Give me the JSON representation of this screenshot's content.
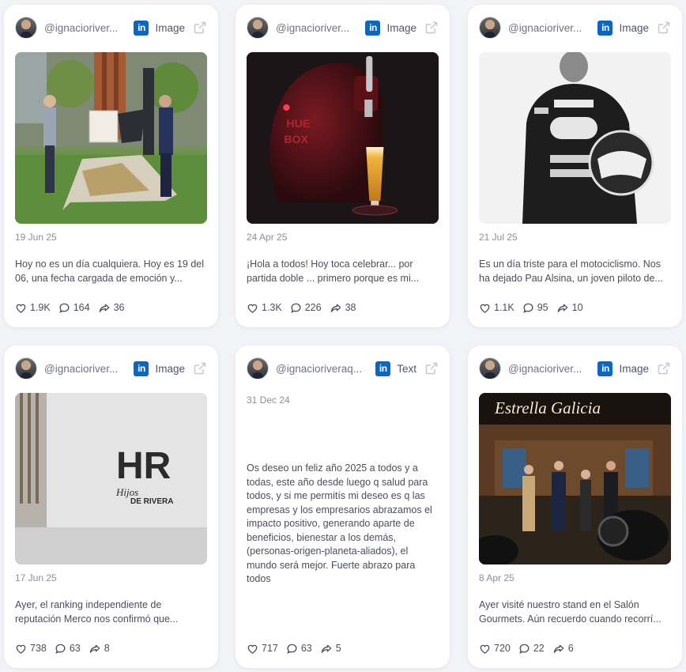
{
  "colors": {
    "background": "#f1f3f7",
    "card": "#ffffff",
    "linkedin": "#0a66c2",
    "muted": "#8a8f9c"
  },
  "posts": [
    {
      "handle": "@ignacioriver...",
      "network_icon": "linkedin-icon",
      "type": "Image",
      "date": "19 Jun 25",
      "text": "Hoy no es un día cualquiera. Hoy es 19 del 06, una fecha cargada de emoción y...",
      "likes": "1.9K",
      "comments": "164",
      "shares": "36"
    },
    {
      "handle": "@ignacioriver...",
      "network_icon": "linkedin-icon",
      "type": "Image",
      "date": "24 Apr 25",
      "text": "¡Hola a todos! Hoy toca celebrar... por partida doble ... primero porque es mi...",
      "likes": "1.3K",
      "comments": "226",
      "shares": "38"
    },
    {
      "handle": "@ignacioriver...",
      "network_icon": "linkedin-icon",
      "type": "Image",
      "date": "21 Jul 25",
      "text": "Es un día triste para el motociclismo. Nos ha dejado Pau Alsina, un joven piloto de...",
      "likes": "1.1K",
      "comments": "95",
      "shares": "10"
    },
    {
      "handle": "@ignacioriver...",
      "network_icon": "linkedin-icon",
      "type": "Image",
      "date": "17 Jun 25",
      "text": "Ayer, el ranking independiente de reputación Merco nos confirmó que...",
      "likes": "738",
      "comments": "63",
      "shares": "8",
      "media_logo": {
        "mark": "HR",
        "line1": "Hijos",
        "line2": "DE RIVERA"
      }
    },
    {
      "handle": "@ignacioriveraq...",
      "network_icon": "linkedin-icon",
      "type": "Text",
      "date": "31 Dec 24",
      "text": "Os deseo un feliz año 2025 a todos y a todas, este año desde luego q salud para todos, y si me permitís mi deseo es q las empresas y los empresarios abrazamos el impacto positivo, generando aparte de beneficios, bienestar a los demás, (personas-origen-planeta-aliados), el mundo será mejor. Fuerte abrazo para todos",
      "likes": "717",
      "comments": "63",
      "shares": "5"
    },
    {
      "handle": "@ignacioriver...",
      "network_icon": "linkedin-icon",
      "type": "Image",
      "date": "8 Apr 25",
      "text": "Ayer visité nuestro stand en el Salón Gourmets. Aún recuerdo cuando recorrí...",
      "likes": "720",
      "comments": "22",
      "shares": "6",
      "media_sign": "Estrella Galicia"
    }
  ]
}
